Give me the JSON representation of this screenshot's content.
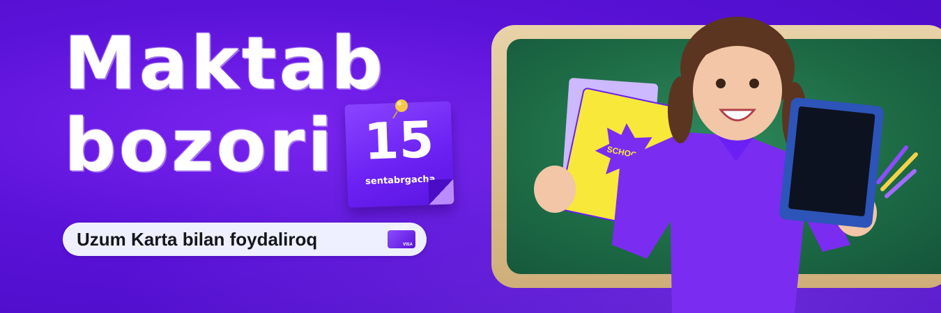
{
  "banner": {
    "title_line1": "Maktab",
    "title_line2": "bozori",
    "calendar": {
      "number": "15",
      "label": "sentabrgacha"
    },
    "pill": {
      "text": "Uzum Karta bilan foydaliroq",
      "card_brand": "uzum",
      "card_network": "VISA"
    },
    "notebook_text": "SCHOOL",
    "colors": {
      "background": "#5a12d8",
      "accent": "#8b4dff",
      "chalkboard": "#1d6b45",
      "frame": "#d9b889",
      "notebook": "#f7e83a",
      "pill_background": "#eef0ff",
      "pill_text": "#14161c"
    },
    "icons": [
      "push-pin-icon",
      "uzum-card-icon"
    ]
  }
}
